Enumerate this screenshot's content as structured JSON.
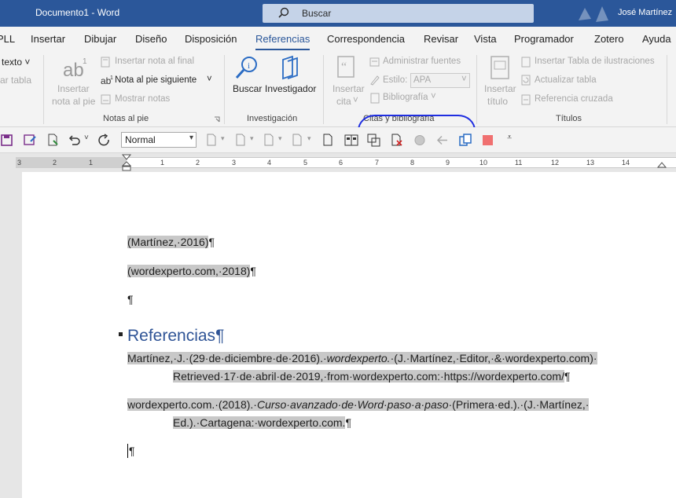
{
  "window": {
    "doc_title": "Documento1  -  Word",
    "search_placeholder": "Buscar",
    "user_name": "José Martínez"
  },
  "tabs": [
    {
      "label": "PLL"
    },
    {
      "label": "Insertar"
    },
    {
      "label": "Dibujar"
    },
    {
      "label": "Diseño"
    },
    {
      "label": "Disposición"
    },
    {
      "label": "Referencias",
      "active": true
    },
    {
      "label": "Correspondencia"
    },
    {
      "label": "Revisar"
    },
    {
      "label": "Vista"
    },
    {
      "label": "Programador"
    },
    {
      "label": "Zotero"
    },
    {
      "label": "Ayuda"
    }
  ],
  "ribbon": {
    "toc": {
      "text_btn": "texto ˅",
      "update_btn": "ar tabla"
    },
    "footnotes": {
      "insert_footnote_l1": "Insertar",
      "insert_footnote_l2": "nota al pie",
      "insert_endnote": "Insertar nota al final",
      "next_footnote": "Nota al pie siguiente",
      "show_notes": "Mostrar notas",
      "group_label": "Notas al pie"
    },
    "research": {
      "search": "Buscar",
      "researcher": "Investigador",
      "group_label": "Investigación"
    },
    "citations": {
      "insert_cite_l1": "Insertar",
      "insert_cite_l2": "cita",
      "manage_sources": "Administrar fuentes",
      "style_label": "Estilo:",
      "style_value": "APA",
      "bibliography": "Bibliografía",
      "group_label": "Citas y bibliografía"
    },
    "captions": {
      "insert_caption_l1": "Insertar",
      "insert_caption_l2": "título",
      "insert_table_figures": "Insertar Tabla de ilustraciones",
      "update_table": "Actualizar tabla",
      "cross_ref": "Referencia cruzada",
      "group_label": "Títulos"
    }
  },
  "qat": {
    "style_value": "Normal"
  },
  "ruler": {
    "numbers": [
      "3",
      "2",
      "1",
      "1",
      "2",
      "3",
      "4",
      "5",
      "6",
      "7",
      "8",
      "9",
      "10",
      "11",
      "12",
      "13",
      "14"
    ]
  },
  "document": {
    "cite1": "(Martínez,·2016)",
    "cite2": "(wordexperto.com,·2018)",
    "empty_para": "¶",
    "heading": "Referencias",
    "pilcrow": "¶",
    "ref1_l1_a": "Martínez,·J.·(29·de·diciembre·de·2016).·",
    "ref1_l1_i": "wordexperto.",
    "ref1_l1_b": "·(J.·Martínez,·Editor,·&·wordexperto.com)·",
    "ref1_l2": "Retrieved·17·de·abril·de·2019,·from·wordexperto.com:·https://wordexperto.com/",
    "ref2_l1_a": "wordexperto.com.·(2018).·",
    "ref2_l1_i": "Curso·avanzado·de·Word·paso·a·paso",
    "ref2_l1_b": "·(Primera·ed.).·(J.·Martínez,·",
    "ref2_l2": "Ed.).·Cartagena:·wordexperto.com.",
    "last_para": "¶"
  }
}
